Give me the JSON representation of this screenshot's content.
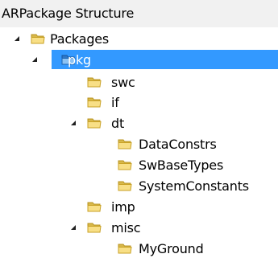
{
  "panel": {
    "title": "ARPackage Structure"
  },
  "tree": {
    "nodes": [
      {
        "label": "Packages",
        "expanded": true,
        "selected": false,
        "icon": "folder-icon"
      },
      {
        "label": "pkg",
        "expanded": true,
        "selected": true,
        "icon": "folder-open-icon"
      },
      {
        "label": "swc",
        "expanded": false,
        "selected": false,
        "icon": "folder-icon"
      },
      {
        "label": "if",
        "expanded": false,
        "selected": false,
        "icon": "folder-icon"
      },
      {
        "label": "dt",
        "expanded": true,
        "selected": false,
        "icon": "folder-icon"
      },
      {
        "label": "DataConstrs",
        "expanded": false,
        "selected": false,
        "icon": "folder-icon"
      },
      {
        "label": "SwBaseTypes",
        "expanded": false,
        "selected": false,
        "icon": "folder-icon"
      },
      {
        "label": "SystemConstants",
        "expanded": false,
        "selected": false,
        "icon": "folder-icon"
      },
      {
        "label": "imp",
        "expanded": false,
        "selected": false,
        "icon": "folder-icon"
      },
      {
        "label": "misc",
        "expanded": true,
        "selected": false,
        "icon": "folder-icon"
      },
      {
        "label": "MyGround",
        "expanded": false,
        "selected": false,
        "icon": "folder-icon"
      }
    ]
  },
  "colors": {
    "selection": "#3399ff",
    "folder_fill": "#f7d774",
    "folder_edge": "#c9a227",
    "title_bar": "#f1f1f1"
  }
}
